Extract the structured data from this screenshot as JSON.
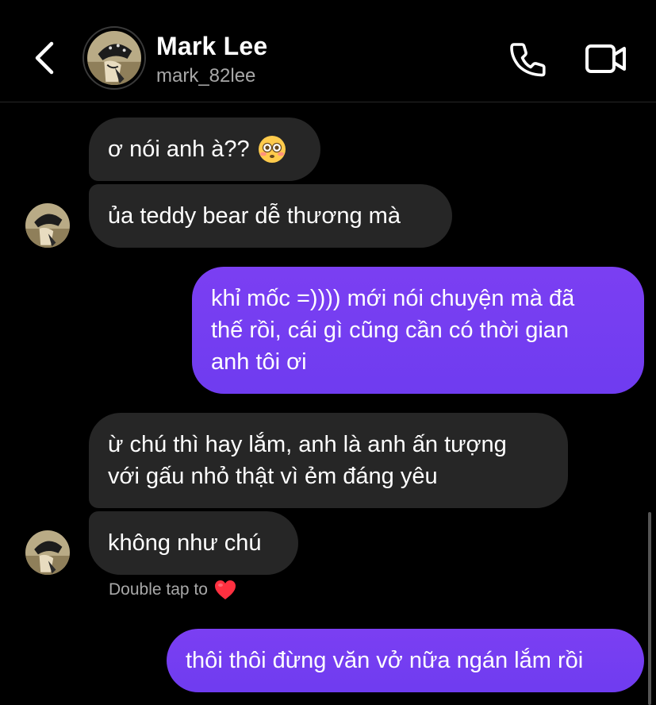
{
  "header": {
    "name": "Mark Lee",
    "username": "mark_82lee"
  },
  "messages": [
    {
      "side": "in",
      "text": "ơ nói anh à??",
      "emoji": "flushed-face-emoji"
    },
    {
      "side": "in",
      "text": "ủa teddy bear dễ thương mà"
    },
    {
      "side": "out",
      "lines": [
        "khỉ mốc =)))) mới nói chuyện mà đã",
        "thế rồi, cái gì cũng cần có thời gian",
        "anh tôi ơi"
      ]
    },
    {
      "side": "in",
      "lines": [
        "ừ chú thì hay lắm, anh là anh ấn tượng",
        "với gấu nhỏ thật vì ẻm đáng yêu"
      ]
    },
    {
      "side": "in",
      "text": "không như chú"
    },
    {
      "side": "out",
      "text": "thôi thôi đừng văn vở nữa ngán lắm rồi"
    }
  ],
  "hint": {
    "text": "Double tap to",
    "icon": "heart-icon"
  },
  "colors": {
    "background": "#000000",
    "incoming_bubble": "#262626",
    "outgoing_bubble": "#7a3df0",
    "secondary_text": "#a8a8a8"
  }
}
